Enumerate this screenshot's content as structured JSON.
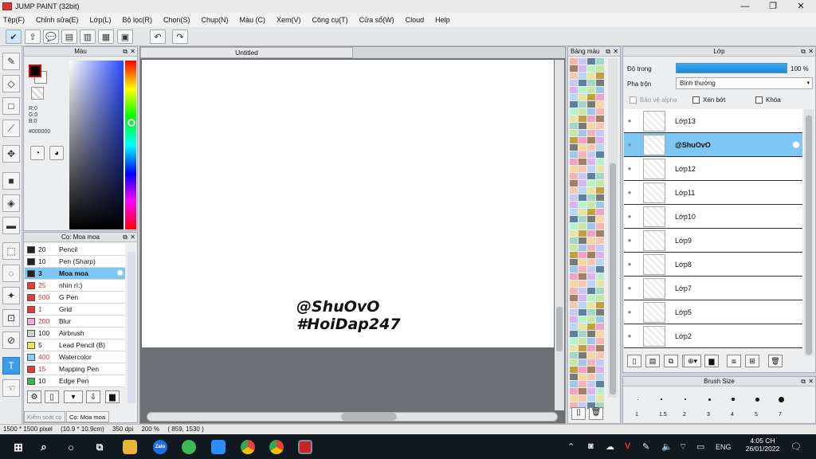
{
  "window": {
    "title": "JUMP PAINT (32bit)",
    "min": "—",
    "max": "❐",
    "close": "✕"
  },
  "menu": [
    "Tệp(F)",
    "Chỉnh sửa(E)",
    "Lớp(L)",
    "Bộ lọc(R)",
    "Chọn(S)",
    "Chụp(N)",
    "Màu (C)",
    "Xem(V)",
    "Công cụ(T)",
    "Cửa sổ(W)",
    "Cloud",
    "Help"
  ],
  "color_panel": {
    "title": "Màu",
    "r": "R:0",
    "g": "G:0",
    "b": "B:0",
    "hex": "#000000"
  },
  "brush_panel": {
    "title": "Cọ: Moa moa",
    "items": [
      {
        "size": "20",
        "name": "Pencil",
        "color": "#222222"
      },
      {
        "size": "10",
        "name": "Pen (Sharp)",
        "color": "#222222"
      },
      {
        "size": "3",
        "name": "Moa moa",
        "color": "#222222"
      },
      {
        "size": "25",
        "name": "nhìn rì:)",
        "color": "#e83b3b"
      },
      {
        "size": "500",
        "name": "G Pen",
        "color": "#e83b3b"
      },
      {
        "size": "1",
        "name": "Grid",
        "color": "#e83b3b"
      },
      {
        "size": "200",
        "name": "Blur",
        "color": "#f2a6e6"
      },
      {
        "size": "100",
        "name": "Airbrush",
        "color": "#cccccc"
      },
      {
        "size": "5",
        "name": "Lead Pencil (B)",
        "color": "#f5e642"
      },
      {
        "size": "400",
        "name": "Watercolor",
        "color": "#7fd3f0"
      },
      {
        "size": "15",
        "name": "Mapping Pen",
        "color": "#e83b3b"
      },
      {
        "size": "10",
        "name": "Edge Pen",
        "color": "#3bb54a"
      }
    ],
    "tab_control": "Kiểm soát cọ",
    "tab_brush": "Cọ: Moa moa"
  },
  "canvas": {
    "tab": "Untitled",
    "watermark_line1": "@ShuOvO",
    "watermark_line2": "#HoiDap247"
  },
  "palette": {
    "title": "Bảng màu"
  },
  "layer_panel": {
    "title": "Lớp",
    "opacity_label": "Độ trong",
    "opacity_value": "100 %",
    "blend_label": "Pha trộn",
    "blend_value": "Bình thường",
    "protect_alpha": "Bảo vệ alpha",
    "clipping": "Xén bớt",
    "lock": "Khóa",
    "layers": [
      "Lớp13",
      "@ShuOvO",
      "Lớp12",
      "Lớp11",
      "Lớp10",
      "Lớp9",
      "Lớp8",
      "Lớp7",
      "Lớp5",
      "Lớp2"
    ]
  },
  "brush_size": {
    "title": "Brush Size",
    "labels": [
      "1",
      "1.5",
      "2",
      "3",
      "4",
      "5",
      "7"
    ]
  },
  "status": {
    "dims": "1500 * 1500 pixel",
    "cm": "(10.9 * 10.9cm)",
    "dpi": "350 dpi",
    "zoom": "200 %",
    "coords": "( 859, 1530 )"
  },
  "taskbar": {
    "lang": "ENG",
    "time": "4:05 CH",
    "date": "26/01/2022",
    "zalo": "Zalo"
  }
}
